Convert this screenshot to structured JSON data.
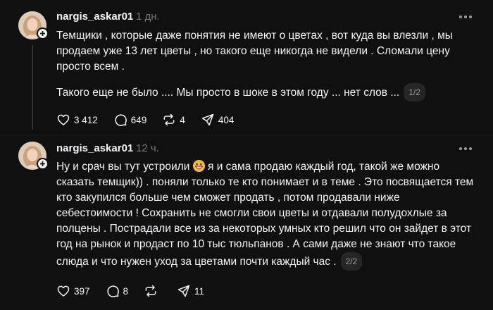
{
  "posts": [
    {
      "username": "nargis_askar01",
      "time": "1 дн.",
      "paragraphs": [
        "Темщики , которые даже понятия не имеют о цветах , вот куда вы влезли , мы продаем уже 13 лет цветы , но такого еще никогда не видели . Сломали цену просто всем .",
        "Такого еще не было .... Мы просто в шоке в этом году ... нет слов ..."
      ],
      "counter": "1/2",
      "likes": "3 412",
      "comments": "649",
      "reposts": "4",
      "shares": "404"
    },
    {
      "username": "nargis_askar01",
      "time": "12 ч.",
      "text_before_emoji": "Ну и срач вы тут устроили ",
      "emoji": "grinning-face-emoji",
      "text_after_emoji": " я и сама продаю каждый год, такой же можно сказать темщик)) . поняли только те кто понимает и в теме . Это посвящается тем кто закупился больше чем сможет продать , потом продавали ниже себестоимости ! Сохранить не смогли свои цветы и отдавали полудохлые за полцены . Пострадали все из за некоторых умных кто решил что он зайдет в этот год на рынок и продаст по 10 тыс тюльпанов . А сами даже не знают что такое слюда и что нужен уход за цветами почти каждый час .",
      "counter": "2/2",
      "likes": "397",
      "comments": "8",
      "reposts": "",
      "shares": "11"
    }
  ],
  "icons": [
    "heart-icon",
    "comment-icon",
    "repost-icon",
    "share-icon",
    "more-icon",
    "follow-plus-icon"
  ],
  "colors": {
    "background": "#101010",
    "text": "#f3f5f7",
    "muted": "#777777",
    "thread_line": "#333638"
  }
}
